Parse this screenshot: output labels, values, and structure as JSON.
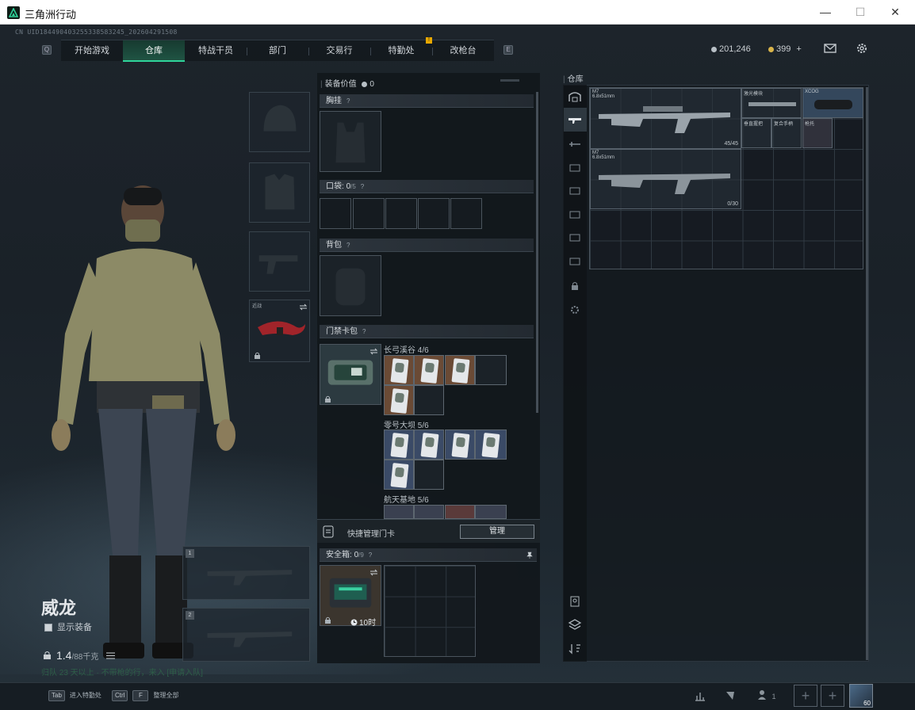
{
  "window": {
    "title": "三角洲行动",
    "minimize": "—",
    "maximize": "☐",
    "close": "✕"
  },
  "header": {
    "uid": "CN UID184490403255338583245_202604291508",
    "tabs": [
      "开始游戏",
      "仓库",
      "特战干员",
      "部门",
      "交易行",
      "特勤处",
      "改枪台"
    ],
    "active_tab": "仓库",
    "key_left": "Q",
    "key_right": "E",
    "alert_badge": "!",
    "silver": "201,246",
    "gold": "399",
    "gold_plus": "+"
  },
  "character": {
    "name": "威龙",
    "show_gear_label": "显示装备",
    "weight_value": "1.4",
    "weight_max": "/88千克",
    "squad_text": "归队 23 天以上 · 不带枪的行，来入 [申请入队]",
    "melee_label": "近战",
    "weapon_slot_1": "1",
    "weapon_slot_2": "2"
  },
  "equipment": {
    "value_label": "装备价值",
    "value": "0",
    "chest_rig": "胸挂",
    "pocket_label": "口袋:",
    "pocket_count": "0",
    "pocket_max": "/5",
    "backpack": "背包",
    "keycard_pack": "门禁卡包",
    "maps": [
      {
        "name": "长弓溪谷",
        "count": "4/6"
      },
      {
        "name": "零号大坝",
        "count": "5/6"
      },
      {
        "name": "航天基地",
        "count": "5/6"
      }
    ],
    "quick_manage": "快捷管理门卡",
    "manage_button": "管理",
    "safebox_label": "安全箱:",
    "safebox_count": "0",
    "safebox_max": "/9",
    "safebox_timer": "10时",
    "help": "?"
  },
  "warehouse": {
    "label": "仓库",
    "items": [
      {
        "name": "M7",
        "caliber": "6.8x51mm",
        "ammo": "45/45"
      },
      {
        "name": "M7",
        "caliber": "6.8x51mm",
        "ammo": "0/30"
      },
      {
        "name": "激光模块"
      },
      {
        "name": "XCOG"
      },
      {
        "name": "垂直握把"
      },
      {
        "name": "复合手柄"
      },
      {
        "name": "枪托"
      }
    ]
  },
  "bottom": {
    "hint1_key": "Tab",
    "hint1": "进入特勤处",
    "hint2_key": "Ctrl",
    "hint2_key2": "F",
    "hint2": "整理全部",
    "friends_count": "1",
    "level": "60"
  },
  "colors": {
    "accent": "#2fd49a",
    "gold": "#e8a800",
    "keycard_warm": "#6a4a35",
    "keycard_cool": "#3a4a66"
  }
}
